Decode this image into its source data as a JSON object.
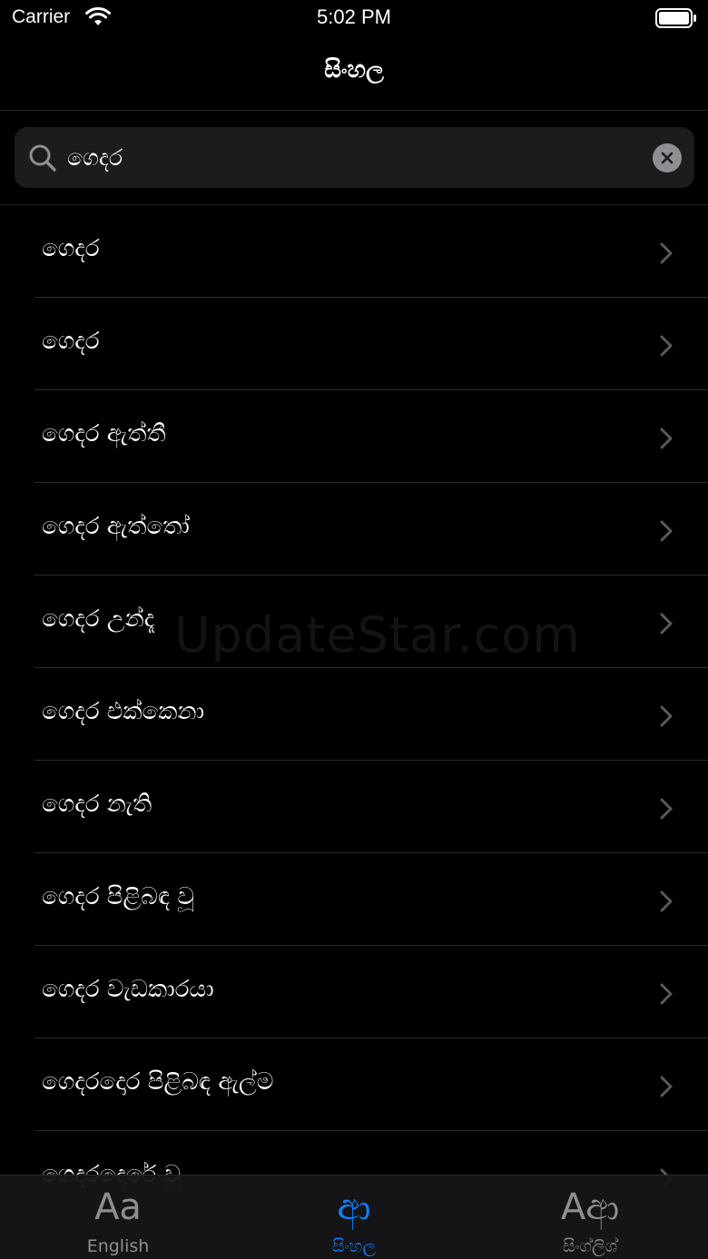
{
  "status_bar": {
    "carrier": "Carrier",
    "time": "5:02 PM"
  },
  "nav": {
    "title": "සිංහල"
  },
  "search": {
    "value": "ගෙදර",
    "placeholder": ""
  },
  "results": [
    {
      "label": "ගෙදර"
    },
    {
      "label": "ගෙදර"
    },
    {
      "label": "ගෙදර ඇත්තී"
    },
    {
      "label": "ගෙදර ඇත්තෝ"
    },
    {
      "label": "ගෙදර උන්දෑ"
    },
    {
      "label": "ගෙදර එක්කෙනා"
    },
    {
      "label": "ගෙදර නැති"
    },
    {
      "label": "ගෙදර පිළිබඳ වූ"
    },
    {
      "label": "ගෙදර වැඩකාරයා"
    },
    {
      "label": "ගෙදරදොර පිළිබඳ ඇල්ම"
    },
    {
      "label": "ගෙදරදොරේ වූ"
    }
  ],
  "watermark": "UpdateStar.com",
  "tabs": [
    {
      "glyph": "Aa",
      "label": "English",
      "active": false
    },
    {
      "glyph": "ආ",
      "label": "සිංහල",
      "active": true
    },
    {
      "glyph": "Aආ",
      "label": "සිංග්ලිශ්",
      "active": false
    }
  ],
  "colors": {
    "background": "#000000",
    "accent": "#0a84ff",
    "inactive": "#8e8e93",
    "search_field": "#1c1c1e"
  }
}
